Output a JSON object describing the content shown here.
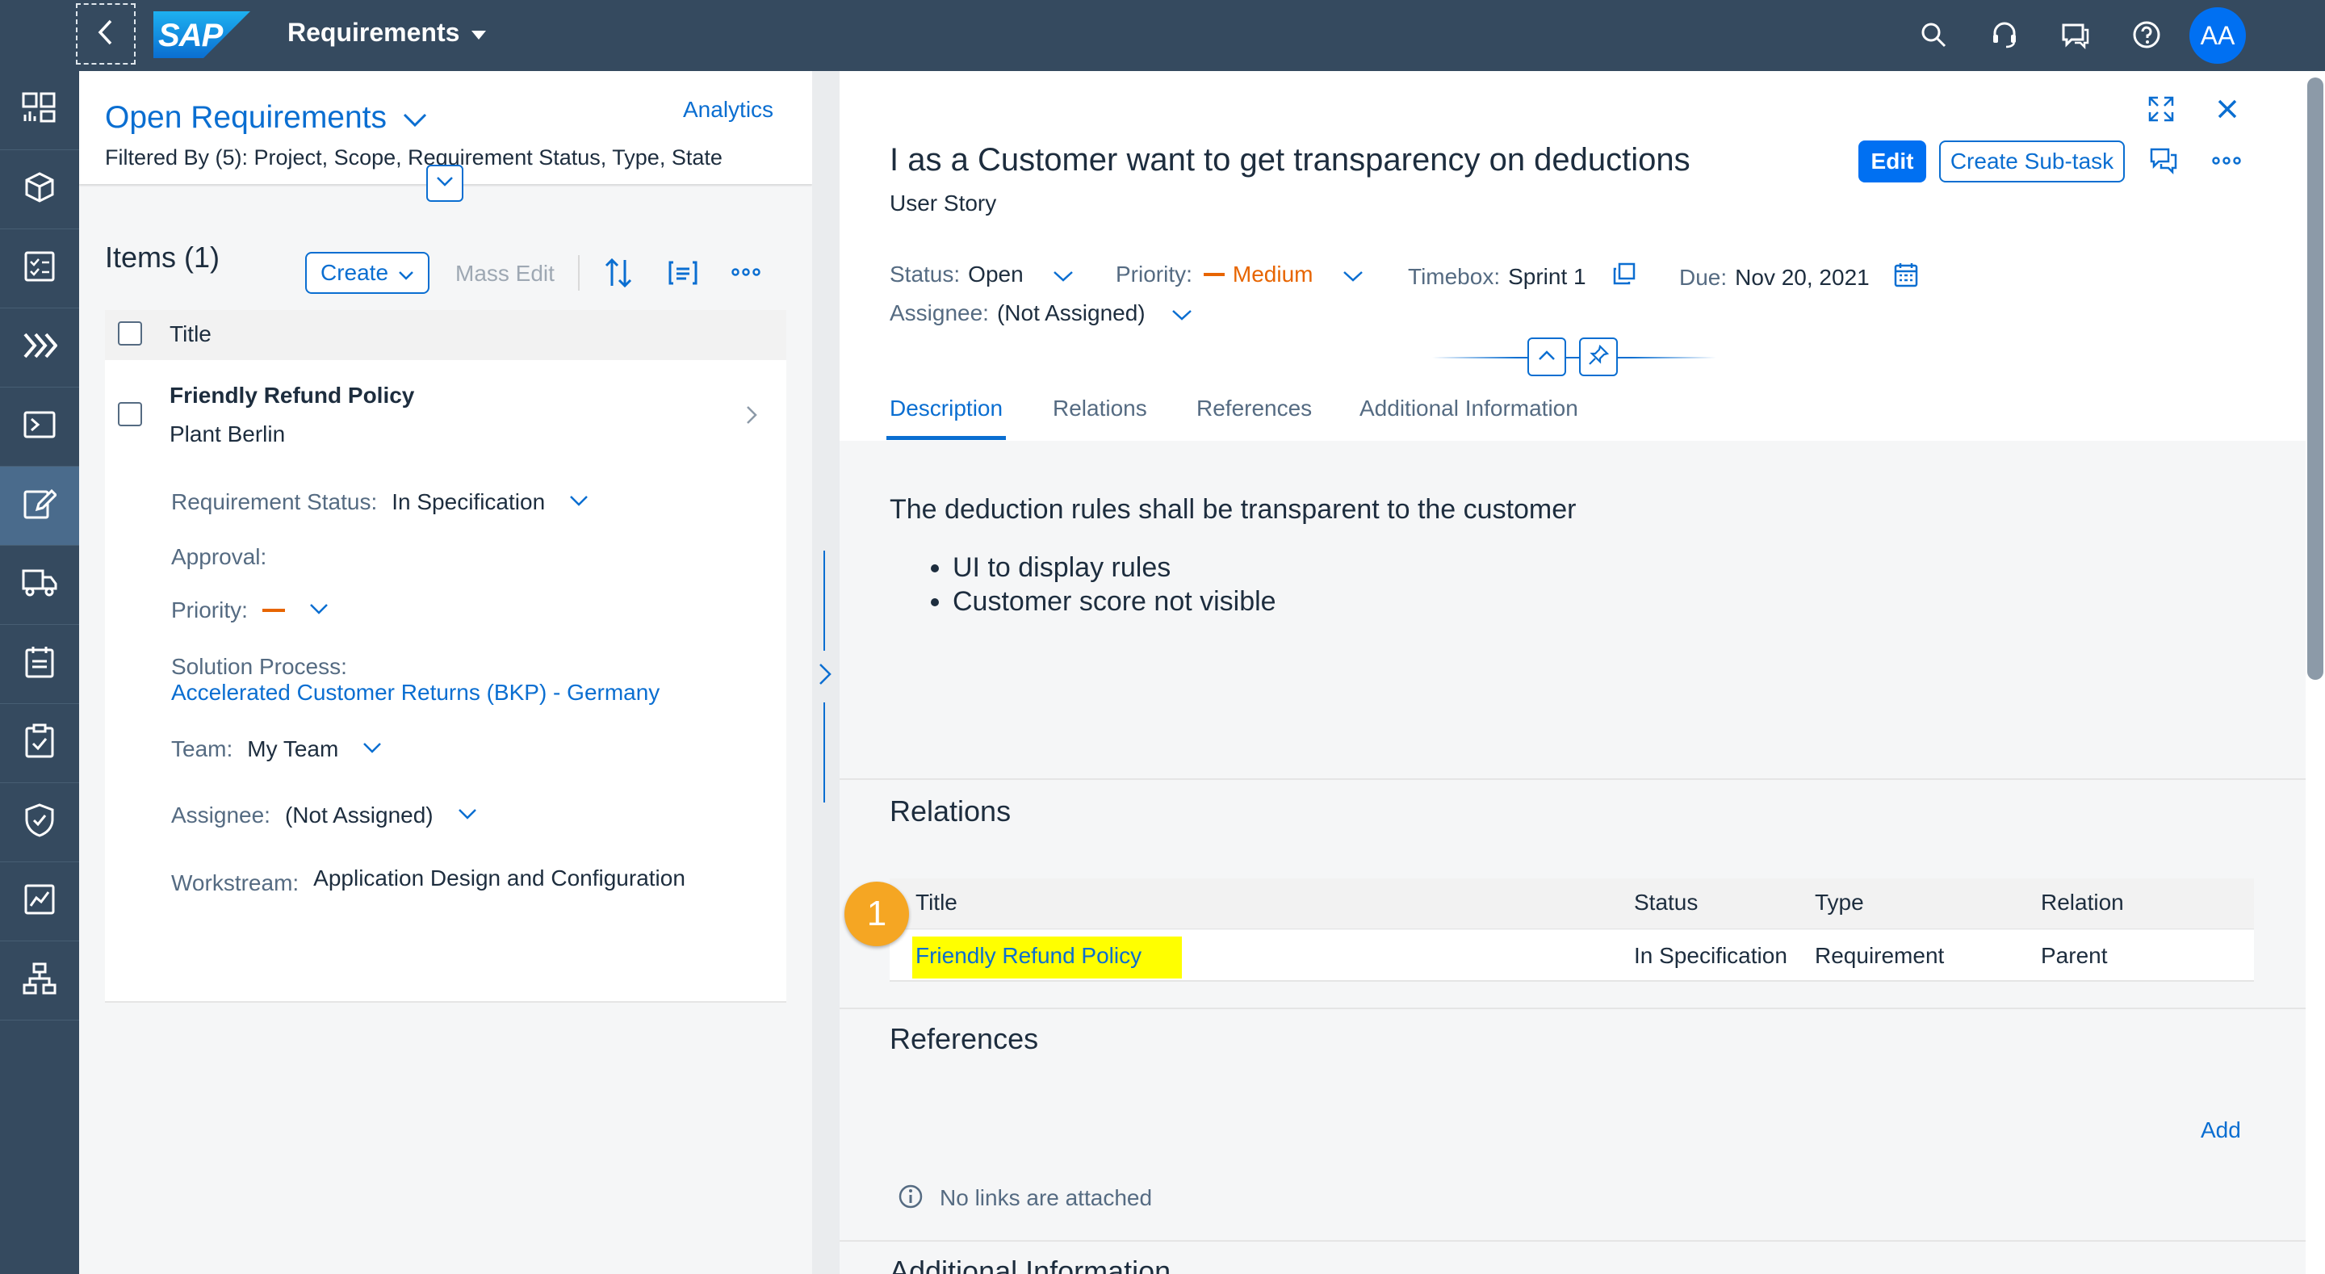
{
  "shell": {
    "logo": "SAP",
    "app_title": "Requirements"
  },
  "list": {
    "title": "Open Requirements",
    "analytics": "Analytics",
    "filtered": "Filtered By (5): Project, Scope, Requirement Status, Type, State",
    "items_count": "Items (1)",
    "create": "Create",
    "mass_edit": "Mass Edit",
    "col_title": "Title",
    "item": {
      "title": "Friendly Refund Policy",
      "subtitle": "Plant Berlin",
      "req_status_label": "Requirement Status:",
      "req_status_value": "In Specification",
      "approval_label": "Approval:",
      "priority_label": "Priority:",
      "solution_label": "Solution Process:",
      "solution_value": "Accelerated Customer Returns (BKP) - Germany",
      "team_label": "Team:",
      "team_value": "My Team",
      "assignee_label": "Assignee:",
      "assignee_value": "(Not Assigned)",
      "workstream_label": "Workstream:",
      "workstream_value": "Application Design and Configuration"
    }
  },
  "detail": {
    "title": "I as a Customer want to get transparency on deductions",
    "subtitle": "User Story",
    "edit": "Edit",
    "create_subtask": "Create Sub-task",
    "status_label": "Status:",
    "status_value": "Open",
    "priority_label": "Priority:",
    "priority_value": "Medium",
    "timebox_label": "Timebox:",
    "timebox_value": "Sprint 1",
    "due_label": "Due:",
    "due_value": "Nov 20, 2021",
    "assignee_label": "Assignee:",
    "assignee_value": "(Not Assigned)",
    "tabs": [
      "Description",
      "Relations",
      "References",
      "Additional Information"
    ],
    "description": "The deduction rules shall be transparent to the customer",
    "bullets": [
      "UI to display rules",
      "Customer score not visible"
    ],
    "relations": {
      "title": "Relations",
      "columns": [
        "Title",
        "Status",
        "Type",
        "Relation"
      ],
      "row": [
        "Friendly Refund Policy",
        "In Specification",
        "Requirement",
        "Parent"
      ]
    },
    "references": {
      "title": "References",
      "add": "Add",
      "empty": "No links are attached"
    },
    "additional_title": "Additional Information"
  },
  "marker_number": "1",
  "avatar": "AA",
  "colors": {
    "shell": "#354a5f",
    "accent": "#0a6ed1",
    "priority": "#e76500",
    "highlight": "#ffff00",
    "marker": "#f5a623"
  }
}
